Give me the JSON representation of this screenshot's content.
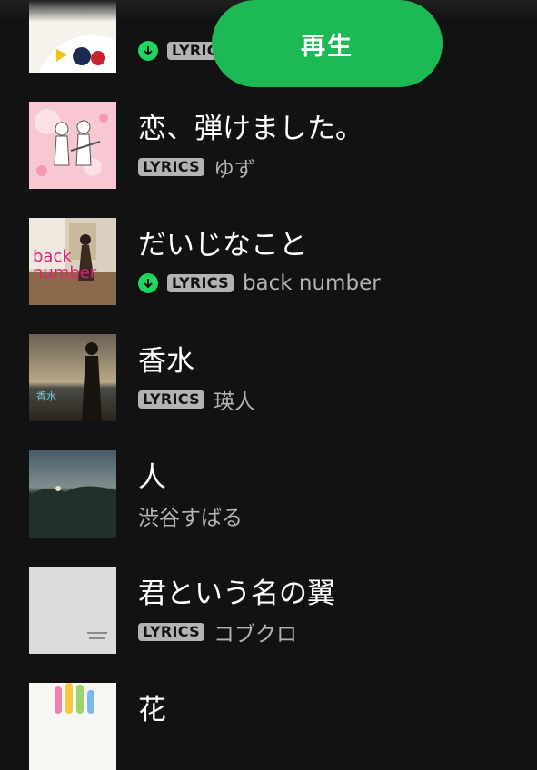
{
  "play_button": {
    "label": "再生"
  },
  "lyrics_badge": "LYRICS",
  "tracks": [
    {
      "title": "",
      "artist": "",
      "lyrics": true,
      "downloaded": true
    },
    {
      "title": "恋、弾けました。",
      "artist": "ゆず",
      "lyrics": true,
      "downloaded": false
    },
    {
      "title": "だいじなこと",
      "artist": "back number",
      "lyrics": true,
      "downloaded": true
    },
    {
      "title": "香水",
      "artist": "瑛人",
      "lyrics": true,
      "downloaded": false
    },
    {
      "title": "人",
      "artist": "渋谷すばる",
      "lyrics": false,
      "downloaded": false
    },
    {
      "title": "君という名の翼",
      "artist": "コブクロ",
      "lyrics": true,
      "downloaded": false
    },
    {
      "title": "花",
      "artist": "",
      "lyrics": false,
      "downloaded": false
    }
  ],
  "colors": {
    "background": "#121212",
    "accent": "#1db954",
    "secondary_text": "#b3b3b3"
  }
}
